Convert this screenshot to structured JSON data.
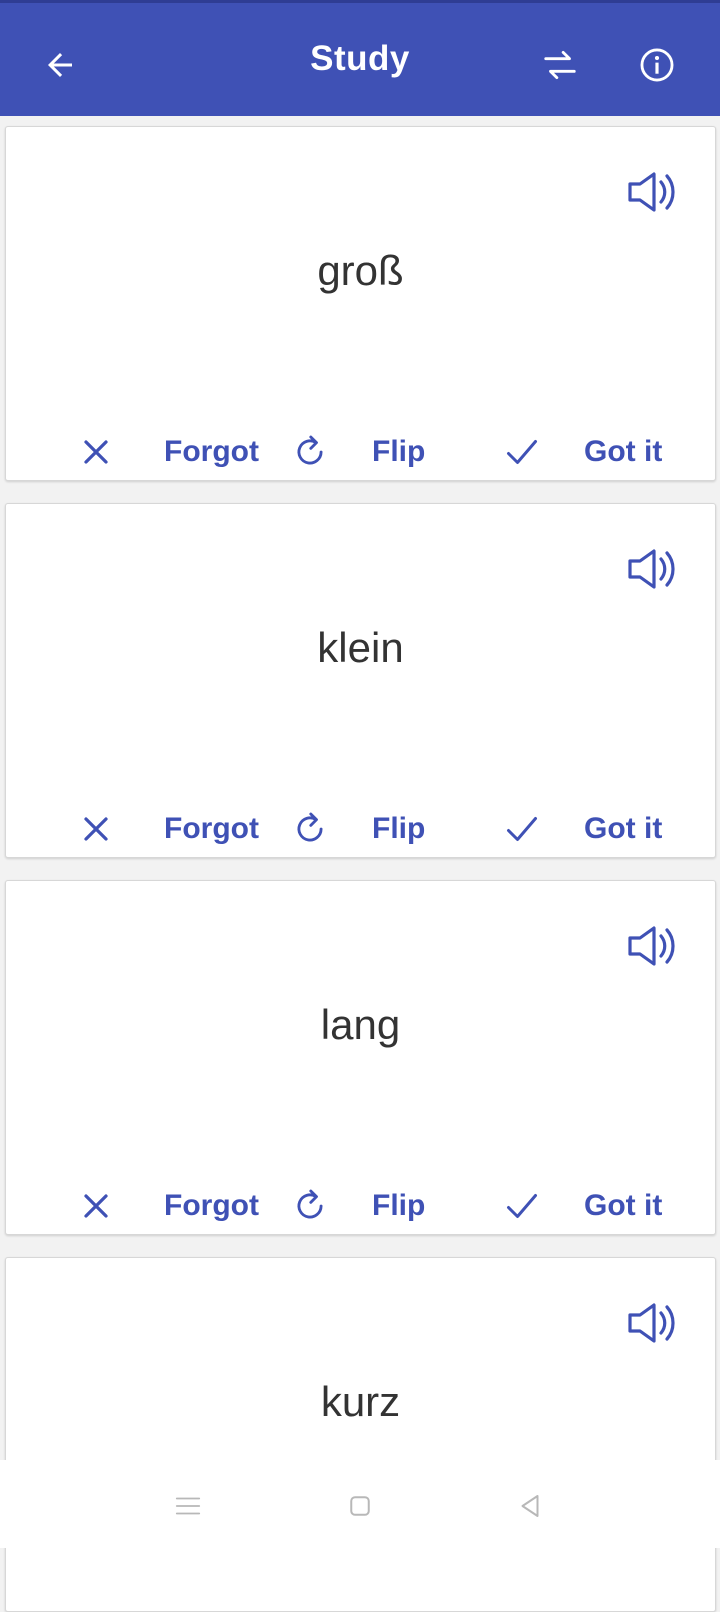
{
  "app_bar": {
    "title": "Study",
    "back_icon": "arrow-left-icon",
    "swap_icon": "swap-horizontal-icon",
    "info_icon": "info-circle-icon",
    "color": "#3f51b5"
  },
  "cards": [
    {
      "word": "groß",
      "forgot_label": "Forgot",
      "flip_label": "Flip",
      "got_it_label": "Got it"
    },
    {
      "word": "klein",
      "forgot_label": "Forgot",
      "flip_label": "Flip",
      "got_it_label": "Got it"
    },
    {
      "word": "lang",
      "forgot_label": "Forgot",
      "flip_label": "Flip",
      "got_it_label": "Got it"
    },
    {
      "word": "kurz"
    }
  ],
  "nav_bar": {
    "menu_icon": "menu-icon",
    "home_icon": "home-square-icon",
    "back_icon": "back-triangle-icon"
  }
}
